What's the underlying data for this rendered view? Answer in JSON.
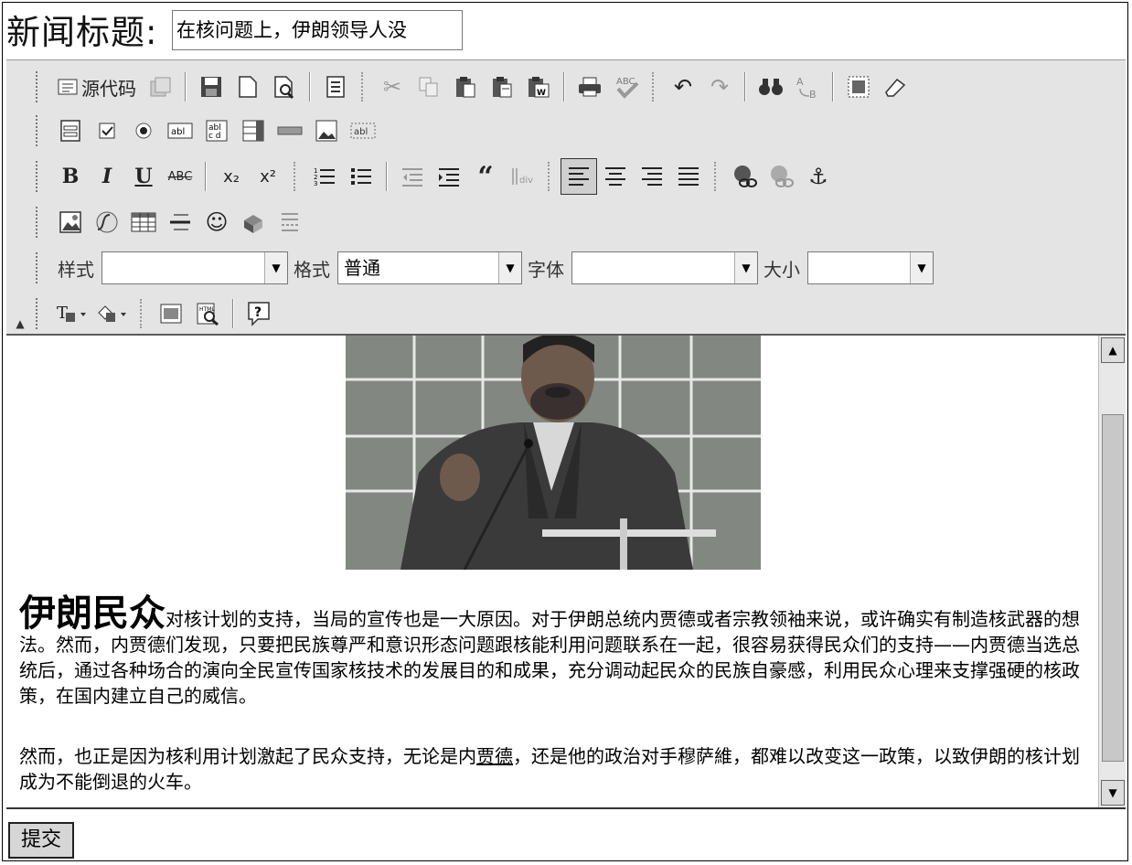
{
  "title": {
    "label": "新闻标题:",
    "value": "在核问题上，伊朗领导人没"
  },
  "toolbar": {
    "source_label": "源代码",
    "style_label": "样式",
    "style_value": "",
    "format_label": "格式",
    "format_value": "普通",
    "font_label": "字体",
    "font_value": "",
    "size_label": "大小",
    "size_value": "",
    "bold": "B",
    "italic": "I",
    "underline": "U",
    "strike": "ABC",
    "subscript": "x₂",
    "superscript": "x²"
  },
  "article": {
    "lead": "伊朗民众",
    "p1": "对核计划的支持，当局的宣传也是一大原因。对于伊朗总统内贾德或者宗教领袖来说，或许确实有制造核武器的想法。然而，内贾德们发现，只要把民族尊严和意识形态问题跟核能利用问题联系在一起，很容易获得民众们的支持——内贾德当选总统后，通过各种场合的演向全民宣传国家核技术的发展目的和成果，充分调动起民众的民族自豪感，利用民众心理来支撑强硬的核政策，在国内建立自己的威信。",
    "p2_a": "然而，也正是因为核利用计划激起了民众支持，无论是内",
    "p2_u": "贾德",
    "p2_b": "，还是他的政治对手穆萨維，都难以改变这一政策，以致伊朗的核计划成为不能倒退的火车。"
  },
  "submit_label": "提交"
}
